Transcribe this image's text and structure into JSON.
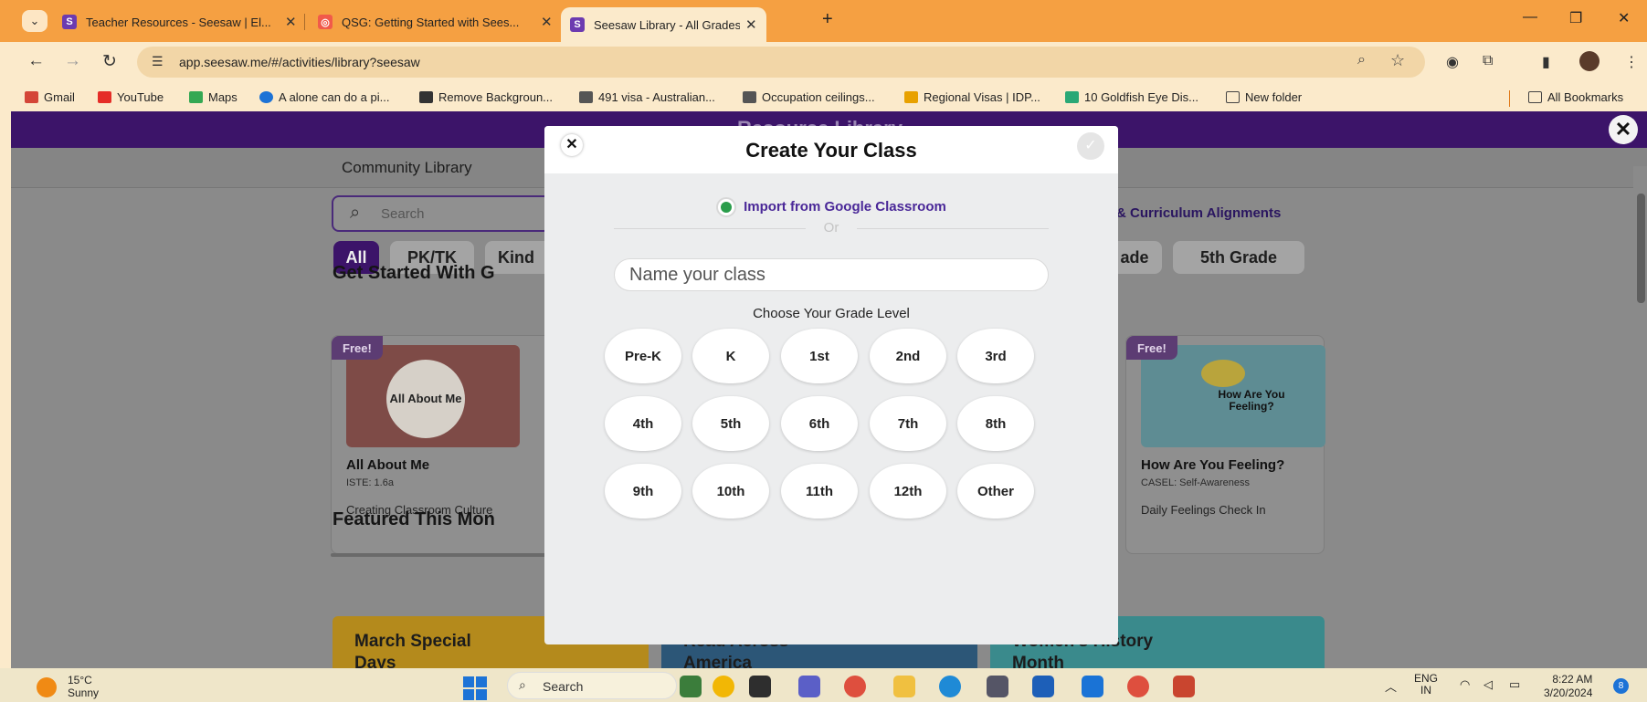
{
  "browser": {
    "tabs": [
      {
        "title": "Teacher Resources - Seesaw | El...",
        "favicon_color": "#6c3bb0",
        "favicon_letter": "S"
      },
      {
        "title": "QSG: Getting Started with Sees...",
        "favicon_color": "#f15a4a",
        "favicon_letter": "◎"
      },
      {
        "title": "Seesaw Library - All Grades - All...",
        "favicon_color": "#6c3bb0",
        "favicon_letter": "S"
      }
    ],
    "url": "app.seesaw.me/#/activities/library?seesaw",
    "bookmarks": [
      {
        "label": "Gmail",
        "icon_color": "#d44638"
      },
      {
        "label": "YouTube",
        "icon_color": "#e52d27"
      },
      {
        "label": "Maps",
        "icon_color": "#34a853"
      },
      {
        "label": "A alone can do a pi...",
        "icon_color": "#1d73d6"
      },
      {
        "label": "Remove Backgroun...",
        "icon_color": "#333333"
      },
      {
        "label": "491 visa - Australian...",
        "icon_color": "#555555"
      },
      {
        "label": "Occupation ceilings...",
        "icon_color": "#555555"
      },
      {
        "label": "Regional Visas | IDP...",
        "icon_color": "#e8a100"
      },
      {
        "label": "10 Goldfish Eye Dis...",
        "icon_color": "#2aa876"
      },
      {
        "label": "New folder",
        "icon_color": "#f0c040"
      }
    ],
    "all_bookmarks": "All Bookmarks"
  },
  "page": {
    "header_title": "Resource Library",
    "community_library": "Community Library",
    "search_placeholder": "Search",
    "curriculum": "& Curriculum Alignments",
    "grade_pills": [
      "All",
      "PK/TK",
      "Kind",
      "ade",
      "5th Grade"
    ],
    "section_get_started": "Get Started With G",
    "section_featured": "Featured This Mon",
    "cards": [
      {
        "free": "Free!",
        "title": "All About Me",
        "standard": "ISTE: 1.6a",
        "category": "Creating Classroom Culture",
        "thumb_text": "All About Me"
      },
      {
        "free": "Free!",
        "title": "How Are You Feeling?",
        "standard": "CASEL: Self-Awareness",
        "category": "Daily Feelings Check In",
        "thumb_text": "How Are You Feeling?"
      }
    ],
    "featured": [
      {
        "title": "March Special Days",
        "color": "#b48a1c"
      },
      {
        "title": "Read Across America",
        "color": "#2c5677"
      },
      {
        "title": "Women's History Month",
        "color": "#3a8a8c"
      }
    ]
  },
  "modal": {
    "title": "Create Your Class",
    "import_label": "Import from Google Classroom",
    "or_label": "Or",
    "name_placeholder": "Name your class",
    "grade_label": "Choose Your Grade Level",
    "grades": [
      "Pre-K",
      "K",
      "1st",
      "2nd",
      "3rd",
      "4th",
      "5th",
      "6th",
      "7th",
      "8th",
      "9th",
      "10th",
      "11th",
      "12th",
      "Other"
    ]
  },
  "taskbar": {
    "temperature": "15°C",
    "weather": "Sunny",
    "search_label": "Search",
    "language": "ENG",
    "region": "IN",
    "time": "8:22 AM",
    "date": "3/20/2024",
    "notifications": "8"
  }
}
